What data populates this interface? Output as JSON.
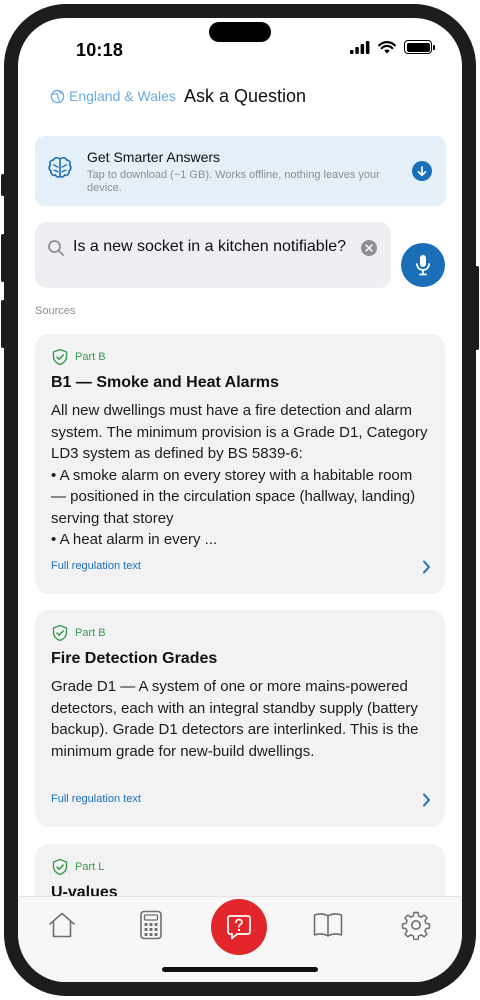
{
  "status_bar": {
    "time": "10:18"
  },
  "header": {
    "region": "England & Wales",
    "title": "Ask a Question"
  },
  "banner": {
    "title": "Get Smarter Answers",
    "subtitle": "Tap to download (~1 GB). Works offline, nothing leaves your device."
  },
  "search": {
    "query": "Is a new socket in a kitchen notifiable?"
  },
  "sources_label": "Sources",
  "cards": [
    {
      "part": "Part B",
      "title": "B1 — Smoke and Heat Alarms",
      "body": "All new dwellings must have a fire detection and alarm system. The minimum provision is a Grade D1, Category LD3 system as defined by BS 5839-6:\n• A smoke alarm on every storey with a habitable room — positioned in the circulation space (hallway, landing) serving that storey\n• A heat alarm in every ...",
      "link": "Full regulation text"
    },
    {
      "part": "Part B",
      "title": "Fire Detection Grades",
      "body": "Grade D1 — A system of one or more mains-powered detectors, each with an integral standby supply (battery backup). Grade D1 detectors are interlinked. This is the minimum grade for new-build dwellings.",
      "link": "Full regulation text"
    },
    {
      "part": "Part L",
      "title": "U-values"
    }
  ],
  "colors": {
    "accent": "#1a6fb8",
    "part_green": "#3a9a4c",
    "ask_red": "#e2262b"
  },
  "tabs": [
    "home-icon",
    "calculator-icon",
    "ask-question-icon",
    "book-icon",
    "gear-icon"
  ]
}
